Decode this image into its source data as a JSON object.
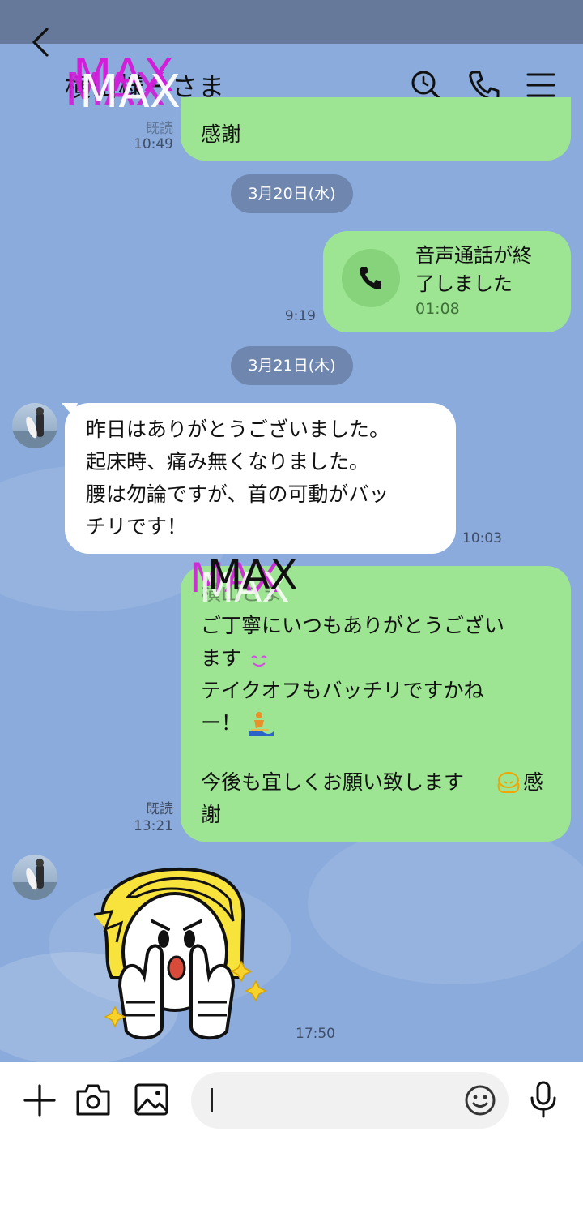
{
  "header": {
    "title": "横山様ーさま",
    "watermark": "MAX"
  },
  "messages": {
    "partial_top": {
      "text": "感謝",
      "read": "既読",
      "time": "10:49"
    },
    "date1": "3月20日(水)",
    "call": {
      "title_line1": "音声通話が終",
      "title_line2": "了しました",
      "duration": "01:08",
      "time": "9:19"
    },
    "date2": "3月21日(木)",
    "incoming1": {
      "lines": [
        "昨日はありがとうございました。",
        "起床時、痛み無くなりました。",
        "腰は勿論ですが、首の可動がバッ",
        "チリです！"
      ],
      "time": "10:03"
    },
    "reply": {
      "line0": "横山さま",
      "line1": "ご丁寧にいつもありがとうござい",
      "line2": "ます",
      "line3": "テイクオフもバッチリですかね",
      "line4": "ー！",
      "line6": "今後も宜しくお願い致します",
      "line6_end": "感",
      "line7": "謝",
      "read": "既読",
      "time": "13:21",
      "watermark": "MAX"
    },
    "sticker": {
      "time": "17:50"
    }
  },
  "input": {
    "placeholder": ""
  },
  "colors": {
    "chat_bg": "#8aabdb",
    "bubble_green": "#9de592",
    "status_bar": "#66799b",
    "watermark": "#d21ed8"
  }
}
